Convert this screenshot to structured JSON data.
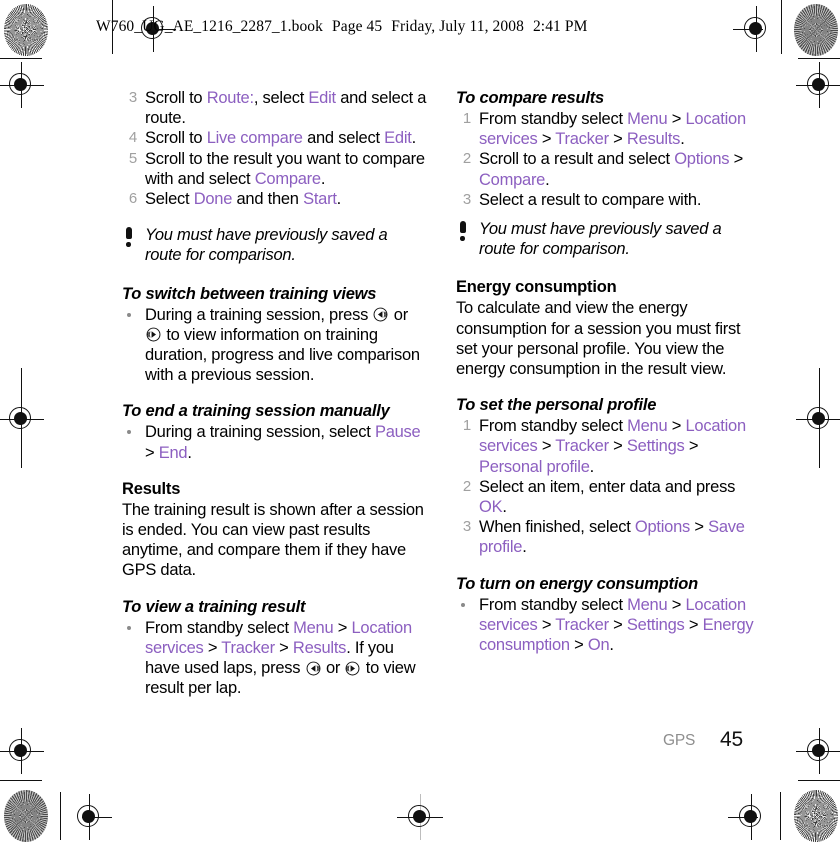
{
  "header": {
    "filename": "W760_UG_AE_1216_2287_1.book",
    "page_label": "Page 45",
    "date": "Friday, July 11, 2008",
    "time": "2:41 PM"
  },
  "footer": {
    "chapter": "GPS",
    "page_number": "45"
  },
  "colors": {
    "ui_reference": "#8c5fc0",
    "step_number": "#a0a0a0",
    "chapter_label": "#8e8e8e",
    "body_text": "#000000"
  },
  "left_column": {
    "steps_continued": [
      {
        "num": "3",
        "parts": [
          {
            "t": "Scroll to ",
            "s": "plain"
          },
          {
            "t": "Route:",
            "s": "ui"
          },
          {
            "t": ", select ",
            "s": "plain"
          },
          {
            "t": "Edit",
            "s": "ui"
          },
          {
            "t": " and select a route.",
            "s": "plain"
          }
        ]
      },
      {
        "num": "4",
        "parts": [
          {
            "t": "Scroll to ",
            "s": "plain"
          },
          {
            "t": "Live compare",
            "s": "ui"
          },
          {
            "t": " and select ",
            "s": "plain"
          },
          {
            "t": "Edit",
            "s": "ui"
          },
          {
            "t": ".",
            "s": "plain"
          }
        ]
      },
      {
        "num": "5",
        "parts": [
          {
            "t": "Scroll to the result you want to compare with and select ",
            "s": "plain"
          },
          {
            "t": "Compare",
            "s": "ui"
          },
          {
            "t": ".",
            "s": "plain"
          }
        ]
      },
      {
        "num": "6",
        "parts": [
          {
            "t": "Select ",
            "s": "plain"
          },
          {
            "t": "Done",
            "s": "ui"
          },
          {
            "t": " and then ",
            "s": "plain"
          },
          {
            "t": "Start",
            "s": "ui"
          },
          {
            "t": ".",
            "s": "plain"
          }
        ]
      }
    ],
    "note_1": "You must have previously saved a route for comparison.",
    "task_switch_views": {
      "heading": "To switch between training views",
      "bullet_parts": [
        {
          "t": "During a training session, press ",
          "s": "plain"
        },
        {
          "t": "",
          "s": "icon-left"
        },
        {
          "t": " or ",
          "s": "plain"
        },
        {
          "t": "",
          "s": "icon-right"
        },
        {
          "t": " to view information on training duration, progress and live comparison with a previous session.",
          "s": "plain"
        }
      ]
    },
    "task_end_session": {
      "heading": "To end a training session manually",
      "bullet_parts": [
        {
          "t": "During a training session, select ",
          "s": "plain"
        },
        {
          "t": "Pause",
          "s": "ui"
        },
        {
          "t": " > ",
          "s": "plain"
        },
        {
          "t": "End",
          "s": "ui"
        },
        {
          "t": ".",
          "s": "plain"
        }
      ]
    },
    "results_section": {
      "heading": "Results",
      "body": "The training result is shown after a session is ended. You can view past results anytime, and compare them if they have GPS data."
    },
    "task_view_result": {
      "heading": "To view a training result",
      "bullet_parts": [
        {
          "t": "From standby select ",
          "s": "plain"
        },
        {
          "t": "Menu",
          "s": "ui"
        },
        {
          "t": " > ",
          "s": "plain"
        },
        {
          "t": "Location services",
          "s": "ui"
        },
        {
          "t": " > ",
          "s": "plain"
        },
        {
          "t": "Tracker",
          "s": "ui"
        },
        {
          "t": " > ",
          "s": "plain"
        },
        {
          "t": "Results",
          "s": "ui"
        },
        {
          "t": ". If you have used laps, press ",
          "s": "plain"
        },
        {
          "t": "",
          "s": "icon-left"
        },
        {
          "t": " or ",
          "s": "plain"
        },
        {
          "t": "",
          "s": "icon-right"
        },
        {
          "t": " to view result per lap.",
          "s": "plain"
        }
      ]
    }
  },
  "right_column": {
    "task_compare_results": {
      "heading": "To compare results",
      "steps": [
        {
          "num": "1",
          "parts": [
            {
              "t": "From standby select ",
              "s": "plain"
            },
            {
              "t": "Menu",
              "s": "ui"
            },
            {
              "t": " > ",
              "s": "plain"
            },
            {
              "t": "Location services",
              "s": "ui"
            },
            {
              "t": " > ",
              "s": "plain"
            },
            {
              "t": "Tracker",
              "s": "ui"
            },
            {
              "t": " > ",
              "s": "plain"
            },
            {
              "t": "Results",
              "s": "ui"
            },
            {
              "t": ".",
              "s": "plain"
            }
          ]
        },
        {
          "num": "2",
          "parts": [
            {
              "t": "Scroll to a result and select ",
              "s": "plain"
            },
            {
              "t": "Options",
              "s": "ui"
            },
            {
              "t": " > ",
              "s": "plain"
            },
            {
              "t": "Compare",
              "s": "ui"
            },
            {
              "t": ".",
              "s": "plain"
            }
          ]
        },
        {
          "num": "3",
          "parts": [
            {
              "t": "Select a result to compare with.",
              "s": "plain"
            }
          ]
        }
      ]
    },
    "note_2": "You must have previously saved a route for comparison.",
    "energy_section": {
      "heading": "Energy consumption",
      "body": "To calculate and view the energy consumption for a session you must first set your personal profile. You view the energy consumption in the result view."
    },
    "task_set_profile": {
      "heading": "To set the personal profile",
      "steps": [
        {
          "num": "1",
          "parts": [
            {
              "t": "From standby select ",
              "s": "plain"
            },
            {
              "t": "Menu",
              "s": "ui"
            },
            {
              "t": " > ",
              "s": "plain"
            },
            {
              "t": "Location services",
              "s": "ui"
            },
            {
              "t": " > ",
              "s": "plain"
            },
            {
              "t": "Tracker",
              "s": "ui"
            },
            {
              "t": " > ",
              "s": "plain"
            },
            {
              "t": "Settings",
              "s": "ui"
            },
            {
              "t": " > ",
              "s": "plain"
            },
            {
              "t": "Personal profile",
              "s": "ui"
            },
            {
              "t": ".",
              "s": "plain"
            }
          ]
        },
        {
          "num": "2",
          "parts": [
            {
              "t": "Select an item, enter data and press ",
              "s": "plain"
            },
            {
              "t": "OK",
              "s": "ui"
            },
            {
              "t": ".",
              "s": "plain"
            }
          ]
        },
        {
          "num": "3",
          "parts": [
            {
              "t": "When finished, select ",
              "s": "plain"
            },
            {
              "t": "Options",
              "s": "ui"
            },
            {
              "t": " > ",
              "s": "plain"
            },
            {
              "t": "Save profile",
              "s": "ui"
            },
            {
              "t": ".",
              "s": "plain"
            }
          ]
        }
      ]
    },
    "task_turn_on_energy": {
      "heading": "To turn on energy consumption",
      "bullet_parts": [
        {
          "t": "From standby select ",
          "s": "plain"
        },
        {
          "t": "Menu",
          "s": "ui"
        },
        {
          "t": " > ",
          "s": "plain"
        },
        {
          "t": "Location services",
          "s": "ui"
        },
        {
          "t": " > ",
          "s": "plain"
        },
        {
          "t": "Tracker",
          "s": "ui"
        },
        {
          "t": " > ",
          "s": "plain"
        },
        {
          "t": "Settings",
          "s": "ui"
        },
        {
          "t": " > ",
          "s": "plain"
        },
        {
          "t": "Energy consumption",
          "s": "ui"
        },
        {
          "t": " > ",
          "s": "plain"
        },
        {
          "t": "On",
          "s": "ui"
        },
        {
          "t": ".",
          "s": "plain"
        }
      ]
    }
  },
  "icons": {
    "nav_left": "nav-key-left-icon",
    "nav_right": "nav-key-right-icon",
    "note": "exclamation-note-icon",
    "registration": "registration-crosshair-icon",
    "density": "density-starburst-icon"
  }
}
